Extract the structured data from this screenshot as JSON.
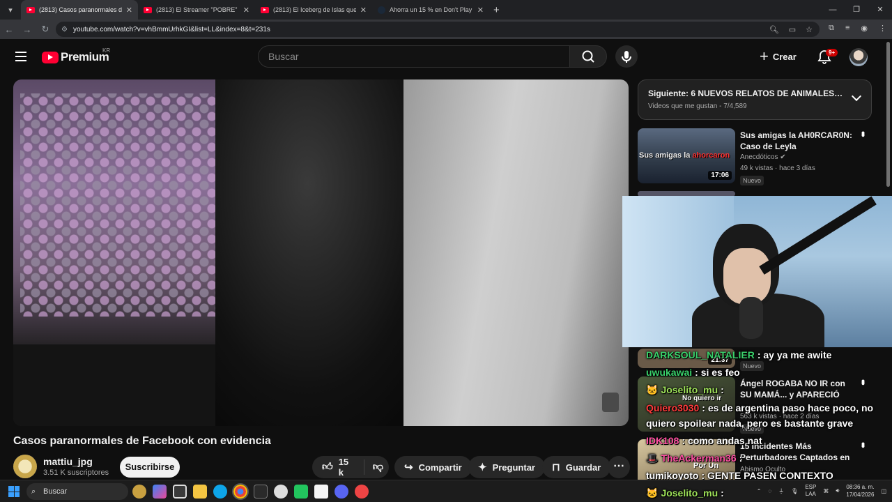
{
  "browser": {
    "tabs": [
      {
        "title": "(2813) Casos paranormales de F",
        "active": true,
        "icon": "youtube-icon"
      },
      {
        "title": "(2813) El Streamer \"POBRE\" Má",
        "active": false,
        "icon": "youtube-icon"
      },
      {
        "title": "(2813) El Iceberg de Islas que e",
        "active": false,
        "icon": "youtube-icon"
      },
      {
        "title": "Ahorra un 15 % en Don't Play T",
        "active": false,
        "icon": "steam-icon"
      }
    ],
    "url": "youtube.com/watch?v=vhBmmUrhkGI&list=LL&index=8&t=231s"
  },
  "youtube": {
    "logo": "Premium",
    "region": "KR",
    "search_placeholder": "Buscar",
    "create_label": "Crear",
    "notifications_badge": "9+"
  },
  "video": {
    "title": "Casos paranormales de Facebook con evidencia",
    "channel": "mattiu_jpg",
    "subscribers": "3.51 K suscriptores",
    "subscribe_label": "Suscribirse",
    "likes": "15 k",
    "share_label": "Compartir",
    "ask_label": "Preguntar",
    "save_label": "Guardar"
  },
  "playlist": {
    "next_title": "Siguiente: 6 NUEVOS RELATOS DE ANIMALES ACT...",
    "subtitle": "Videos que me gustan - 7/4,589"
  },
  "recommendations": [
    {
      "title": "Sus amigas la AH0RCAR0N: Caso de Leyla",
      "channel": "Anecdóticos",
      "meta": "49 k vistas · hace 3 días",
      "badge": "Nuevo",
      "duration": "17:06",
      "thumb_text_1": "Sus amigas la ",
      "thumb_text_2": "ahorcaron"
    },
    {
      "title": "Ángel ROGABA NO IR con SU MAMÁ... y APARECIÓ MU3RT...",
      "meta": "563 k vistas · hace 2 días",
      "badge": "Nuevo",
      "duration": "21:37",
      "thumb_text_1": "No quiero ir",
      "thumb_text_2": ""
    },
    {
      "title": "15 Incidentes Más Perturbadores Captados en ...",
      "channel": "Abismo Oculto",
      "thumb_text_1": "Por Un",
      "thumb_text_2": ""
    }
  ],
  "chat": [
    {
      "user": "DARKSOUL_NATALIER",
      "msg": ": ay ya me awite",
      "color": "#3ad16b"
    },
    {
      "user": "uwukawai",
      "msg": ": si es feo",
      "color": "#3ad16b"
    },
    {
      "user": "Joselito_mu",
      "msg": ":",
      "color": "#9fe35a"
    },
    {
      "user": "Quiero3030",
      "msg": ": es de argentina paso hace poco, no",
      "color": "#ff3b3b"
    },
    {
      "user": "",
      "msg": "quiero spoilear nada, pero es bastante grave",
      "color": "#ffffff"
    },
    {
      "user": "IDK108",
      "msg": ": como andas nat",
      "color": "#ff4fa3"
    },
    {
      "user": "TheAckerman36",
      "msg": ":",
      "color": "#ff4fa3"
    },
    {
      "user": "tumikoyoto",
      "msg": ": GENTE PASEN CONTEXTO",
      "color": "#ffffff"
    },
    {
      "user": "Joselito_mu",
      "msg": ":",
      "color": "#9fe35a"
    }
  ],
  "taskbar": {
    "search_label": "Buscar",
    "lang_1": "ESP",
    "lang_2": "LAA",
    "time": "08:36 a. m.",
    "date": "17/04/2026"
  }
}
